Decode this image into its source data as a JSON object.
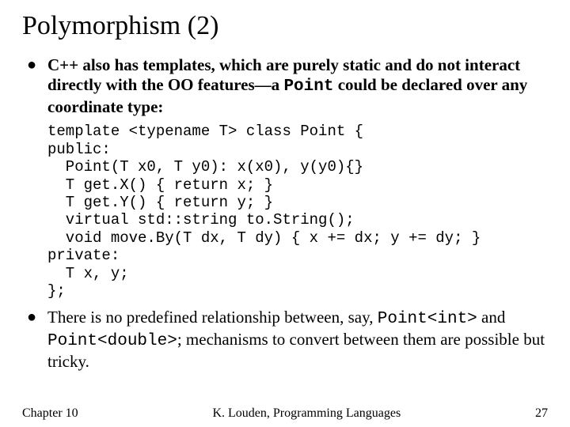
{
  "title": "Polymorphism (2)",
  "bullets": [
    {
      "parts": [
        {
          "t": "C++ also has templates, which are purely static and do not interact directly with the OO features—a ",
          "cls": "bold"
        },
        {
          "t": "Point",
          "cls": "bold mono"
        },
        {
          "t": " could be declared over any coordinate type:",
          "cls": "bold"
        }
      ]
    },
    {
      "parts": [
        {
          "t": "There is no predefined relationship between, say, ",
          "cls": ""
        },
        {
          "t": "Point<int>",
          "cls": "mono"
        },
        {
          "t": " and ",
          "cls": ""
        },
        {
          "t": "Point<double>",
          "cls": "mono"
        },
        {
          "t": "; mechanisms to convert between them are possible but tricky.",
          "cls": ""
        }
      ]
    }
  ],
  "code": "template <typename T> class Point {\npublic:\n  Point(T x0, T y0): x(x0), y(y0){}\n  T get.X() { return x; }\n  T get.Y() { return y; }\n  virtual std::string to.String();\n  void move.By(T dx, T dy) { x += dx; y += dy; }\nprivate:\n  T x, y;\n};",
  "footer": {
    "left": "Chapter 10",
    "center": "K. Louden, Programming Languages",
    "right": "27"
  },
  "chart_data": {
    "type": "table",
    "title": "",
    "categories": [],
    "values": []
  }
}
